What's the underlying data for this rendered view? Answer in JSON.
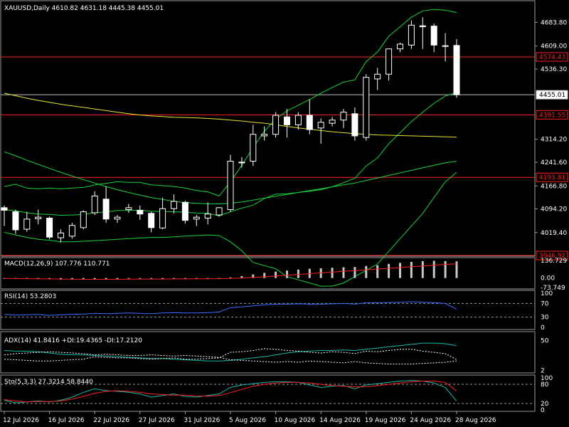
{
  "window": {
    "symbol_line": "XAUUSD,Daily  4610.82 4631.18 4445.38 4455.01",
    "background": "#000000",
    "grid_color": "#ffffff",
    "bull_color": "#ffffff",
    "bear_color": "#ffffff"
  },
  "chart_data": [
    {
      "type": "candlestick",
      "ylim": [
        3946.92,
        4750
      ],
      "yticks": [
        "4683.80",
        "4609.00",
        "4536.30",
        "4314.20",
        "4241.60",
        "4166.80",
        "4094.20",
        "4019.40"
      ],
      "ytick_values": [
        4683.8,
        4609.0,
        4536.3,
        4314.2,
        4241.6,
        4166.8,
        4094.2,
        4019.4
      ],
      "price_tags": [
        {
          "label": "4574.43",
          "value": 4574.43,
          "color": "#ff2020",
          "text_color": "#ff2020"
        },
        {
          "label": "4455.01",
          "value": 4455.01,
          "color": "#c0c0c0",
          "text_color": "#000000",
          "fill": "#ffffff"
        },
        {
          "label": "4391.55",
          "value": 4391.55,
          "color": "#ff2020",
          "text_color": "#ff2020"
        },
        {
          "label": "4193.81",
          "value": 4193.81,
          "color": "#ff2020",
          "text_color": "#ff2020"
        },
        {
          "label": "3946.92",
          "value": 3946.92,
          "color": "#ff2020",
          "text_color": "#ff2020"
        }
      ],
      "xticks": [
        "12 Jul 2026",
        "16 Jul 2026",
        "22 Jul 2026",
        "27 Jul 2026",
        "31 Jul 2026",
        "5 Aug 2026",
        "10 Aug 2026",
        "14 Aug 2026",
        "19 Aug 2026",
        "24 Aug 2026",
        "28 Aug 2026"
      ],
      "xtick_bars": [
        0,
        4,
        8,
        12,
        16,
        20,
        24,
        28,
        32,
        36,
        40
      ],
      "candles": [
        {
          "o": 4098,
          "h": 4105,
          "l": 4040,
          "c": 4090
        },
        {
          "o": 4085,
          "h": 4092,
          "l": 4015,
          "c": 4028
        },
        {
          "o": 4030,
          "h": 4085,
          "l": 4022,
          "c": 4062
        },
        {
          "o": 4063,
          "h": 4092,
          "l": 4045,
          "c": 4068
        },
        {
          "o": 4065,
          "h": 4070,
          "l": 3998,
          "c": 4005
        },
        {
          "o": 4003,
          "h": 4030,
          "l": 3988,
          "c": 4018
        },
        {
          "o": 4008,
          "h": 4050,
          "l": 4000,
          "c": 4042
        },
        {
          "o": 4035,
          "h": 4090,
          "l": 4030,
          "c": 4085
        },
        {
          "o": 4082,
          "h": 4150,
          "l": 4075,
          "c": 4135
        },
        {
          "o": 4125,
          "h": 4165,
          "l": 4050,
          "c": 4062
        },
        {
          "o": 4062,
          "h": 4075,
          "l": 4050,
          "c": 4068
        },
        {
          "o": 4092,
          "h": 4110,
          "l": 4082,
          "c": 4098
        },
        {
          "o": 4090,
          "h": 4105,
          "l": 4060,
          "c": 4078
        },
        {
          "o": 4080,
          "h": 4085,
          "l": 4020,
          "c": 4035
        },
        {
          "o": 4034,
          "h": 4130,
          "l": 4030,
          "c": 4095
        },
        {
          "o": 4095,
          "h": 4140,
          "l": 4080,
          "c": 4118
        },
        {
          "o": 4115,
          "h": 4120,
          "l": 4048,
          "c": 4058
        },
        {
          "o": 4062,
          "h": 4075,
          "l": 4040,
          "c": 4068
        },
        {
          "o": 4065,
          "h": 4115,
          "l": 4045,
          "c": 4078
        },
        {
          "o": 4075,
          "h": 4100,
          "l": 4070,
          "c": 4098
        },
        {
          "o": 4092,
          "h": 4265,
          "l": 4085,
          "c": 4245
        },
        {
          "o": 4240,
          "h": 4258,
          "l": 4225,
          "c": 4242
        },
        {
          "o": 4245,
          "h": 4360,
          "l": 4230,
          "c": 4330
        },
        {
          "o": 4325,
          "h": 4355,
          "l": 4310,
          "c": 4330
        },
        {
          "o": 4330,
          "h": 4400,
          "l": 4320,
          "c": 4390
        },
        {
          "o": 4385,
          "h": 4410,
          "l": 4320,
          "c": 4360
        },
        {
          "o": 4360,
          "h": 4400,
          "l": 4345,
          "c": 4390
        },
        {
          "o": 4390,
          "h": 4440,
          "l": 4330,
          "c": 4345
        },
        {
          "o": 4350,
          "h": 4380,
          "l": 4300,
          "c": 4368
        },
        {
          "o": 4365,
          "h": 4385,
          "l": 4355,
          "c": 4375
        },
        {
          "o": 4375,
          "h": 4410,
          "l": 4350,
          "c": 4400
        },
        {
          "o": 4395,
          "h": 4415,
          "l": 4310,
          "c": 4325
        },
        {
          "o": 4320,
          "h": 4520,
          "l": 4310,
          "c": 4510
        },
        {
          "o": 4505,
          "h": 4540,
          "l": 4470,
          "c": 4520
        },
        {
          "o": 4520,
          "h": 4590,
          "l": 4500,
          "c": 4600
        },
        {
          "o": 4600,
          "h": 4620,
          "l": 4590,
          "c": 4615
        },
        {
          "o": 4612,
          "h": 4690,
          "l": 4600,
          "c": 4675
        },
        {
          "o": 4673,
          "h": 4700,
          "l": 4600,
          "c": 4670
        },
        {
          "o": 4672,
          "h": 4680,
          "l": 4590,
          "c": 4612
        },
        {
          "o": 4608,
          "h": 4650,
          "l": 4560,
          "c": 4610
        },
        {
          "o": 4610.82,
          "h": 4631.18,
          "l": 4445.38,
          "c": 4455.01
        }
      ],
      "ma_yellow": [
        4460,
        4452,
        4444,
        4437,
        4431,
        4425,
        4420,
        4415,
        4410,
        4405,
        4400,
        4395,
        4391,
        4388,
        4386,
        4384,
        4383,
        4382,
        4380,
        4378,
        4375,
        4372,
        4368,
        4365,
        4360,
        4355,
        4350,
        4346,
        4342,
        4338,
        4335,
        4332,
        4330,
        4328,
        4327,
        4326,
        4325,
        4324,
        4323,
        4322,
        4321
      ],
      "ma_green_mid": [
        4275,
        4262,
        4248,
        4235,
        4222,
        4210,
        4198,
        4187,
        4176,
        4165,
        4155,
        4146,
        4138,
        4130,
        4124,
        4118,
        4114,
        4112,
        4110,
        4110,
        4112,
        4116,
        4122,
        4128,
        4134,
        4140,
        4146,
        4152,
        4158,
        4164,
        4170,
        4176,
        4184,
        4192,
        4200,
        4208,
        4216,
        4224,
        4232,
        4240,
        4245
      ],
      "bb_upper": [
        4165,
        4172,
        4160,
        4158,
        4160,
        4158,
        4160,
        4162,
        4170,
        4175,
        4180,
        4178,
        4178,
        4170,
        4168,
        4165,
        4160,
        4152,
        4148,
        4135,
        4180,
        4232,
        4288,
        4340,
        4378,
        4404,
        4422,
        4440,
        4460,
        4478,
        4495,
        4502,
        4560,
        4590,
        4640,
        4670,
        4700,
        4720,
        4725,
        4722,
        4715
      ],
      "bb_lower": [
        4020,
        4012,
        4004,
        3998,
        3995,
        3990,
        3990,
        3992,
        3994,
        3996,
        3998,
        4000,
        4002,
        4004,
        4004,
        4006,
        4008,
        4010,
        4012,
        4010,
        3990,
        3962,
        3925,
        3915,
        3905,
        3880,
        3870,
        3860,
        3850,
        3850,
        3860,
        3880,
        3900,
        3920,
        3960,
        4000,
        4040,
        4080,
        4130,
        4180,
        4210
      ],
      "bb_mid": [
        4092,
        4088,
        4082,
        4078,
        4077,
        4074,
        4075,
        4077,
        4082,
        4085,
        4089,
        4089,
        4090,
        4087,
        4086,
        4085,
        4084,
        4081,
        4080,
        4072,
        4085,
        4097,
        4106,
        4127,
        4141,
        4142,
        4146,
        4150,
        4155,
        4164,
        4177,
        4191,
        4230,
        4255,
        4300,
        4335,
        4370,
        4400,
        4428,
        4451,
        4462
      ]
    },
    {
      "type": "bar",
      "name": "MACD(12,26,9) 107.776 110.771",
      "label": "MACD(12,26,9) 107.776 110.771",
      "yticks": [
        "136.729",
        "0.00",
        "-73.749"
      ],
      "ylim": [
        -73.749,
        136.729
      ],
      "histogram": [
        -2,
        -4,
        -6,
        -8,
        -10,
        -12,
        -12,
        -11,
        -9,
        -8,
        -7,
        -6,
        -5,
        -6,
        -7,
        -6,
        -5,
        -5,
        -4,
        -3,
        5,
        15,
        28,
        40,
        50,
        58,
        66,
        72,
        76,
        80,
        84,
        86,
        94,
        100,
        110,
        118,
        126,
        132,
        134,
        132,
        130
      ],
      "signal": [
        -3,
        -4,
        -5,
        -6,
        -7,
        -8,
        -9,
        -10,
        -10,
        -10,
        -10,
        -9,
        -8,
        -8,
        -8,
        -7,
        -7,
        -6,
        -6,
        -5,
        -3,
        0,
        5,
        10,
        16,
        22,
        28,
        34,
        40,
        46,
        52,
        58,
        64,
        70,
        76,
        82,
        88,
        94,
        100,
        106,
        110.771
      ]
    },
    {
      "type": "line",
      "name": "RSI(14) 53.2803",
      "label": "RSI(14) 53.2803",
      "yticks": [
        "100",
        "70",
        "30",
        "0"
      ],
      "ylim": [
        0,
        100
      ],
      "levels": [
        70,
        30
      ],
      "values": [
        38,
        36,
        37,
        38,
        35,
        37,
        38,
        39,
        41,
        40,
        41,
        42,
        41,
        40,
        42,
        43,
        42,
        42,
        43,
        45,
        58,
        60,
        63,
        66,
        68,
        68,
        69,
        68,
        68,
        69,
        70,
        68,
        72,
        72,
        73,
        74,
        75,
        74,
        72,
        70,
        53.28
      ]
    },
    {
      "type": "line",
      "name": "ADX(14) 41.8416 +DI:19.4365 -DI:17.2120",
      "label": "ADX(14) 41.8416 +DI:19.4365 -DI:17.2120",
      "yticks": [
        "50",
        "2"
      ],
      "ylim": [
        0,
        60
      ],
      "series": [
        {
          "name": "ADX",
          "values": [
            34,
            33,
            33,
            32,
            30,
            28,
            27,
            27,
            26,
            25,
            24,
            23,
            22,
            21,
            21,
            20,
            19,
            18,
            17,
            17,
            18,
            20,
            22,
            24,
            27,
            30,
            32,
            33,
            34,
            34,
            35,
            34,
            36,
            38,
            40,
            42,
            44,
            46,
            46,
            45,
            41.84
          ]
        },
        {
          "name": "+DI",
          "values": [
            20,
            19,
            18,
            17,
            17,
            18,
            19,
            20,
            24,
            23,
            22,
            22,
            21,
            20,
            21,
            22,
            20,
            20,
            21,
            22,
            31,
            32,
            34,
            37,
            36,
            34,
            33,
            31,
            30,
            32,
            31,
            29,
            33,
            32,
            34,
            36,
            36,
            33,
            31,
            29,
            19.44
          ]
        },
        {
          "name": "-DI",
          "values": [
            27,
            29,
            30,
            31,
            32,
            31,
            30,
            29,
            27,
            28,
            27,
            26,
            26,
            27,
            26,
            25,
            26,
            25,
            24,
            23,
            19,
            18,
            17,
            16,
            15,
            16,
            15,
            17,
            16,
            15,
            14,
            16,
            14,
            13,
            12,
            12,
            12,
            13,
            14,
            15,
            17.21
          ]
        }
      ]
    },
    {
      "type": "line",
      "name": "Sto(5,3,3) 27.3214 58.8440",
      "label": "Sto(5,3,3) 27.3214 58.8440",
      "yticks": [
        "100",
        "80",
        "20",
        "0"
      ],
      "ylim": [
        0,
        100
      ],
      "levels": [
        80,
        20
      ],
      "series": [
        {
          "name": "%K",
          "values": [
            30,
            22,
            25,
            28,
            25,
            30,
            40,
            55,
            66,
            60,
            58,
            55,
            50,
            40,
            45,
            50,
            42,
            40,
            45,
            50,
            70,
            78,
            82,
            86,
            88,
            88,
            86,
            78,
            70,
            74,
            76,
            66,
            78,
            82,
            86,
            90,
            92,
            90,
            84,
            70,
            27.32
          ]
        },
        {
          "name": "%D",
          "values": [
            32,
            28,
            25,
            26,
            26,
            28,
            34,
            42,
            52,
            58,
            60,
            58,
            55,
            50,
            48,
            46,
            46,
            44,
            43,
            45,
            54,
            64,
            74,
            80,
            84,
            86,
            86,
            84,
            80,
            76,
            74,
            72,
            72,
            76,
            80,
            84,
            88,
            90,
            90,
            86,
            58.84
          ]
        }
      ]
    }
  ],
  "panels": {
    "macd": {
      "label": "MACD(12,26,9) 107.776 110.771"
    },
    "rsi": {
      "label": "RSI(14) 53.2803"
    },
    "adx": {
      "label": "ADX(14) 41.8416 +DI:19.4365 -DI:17.2120"
    },
    "sto": {
      "label": "Sto(5,3,3) 27.3214 58.8440"
    }
  }
}
